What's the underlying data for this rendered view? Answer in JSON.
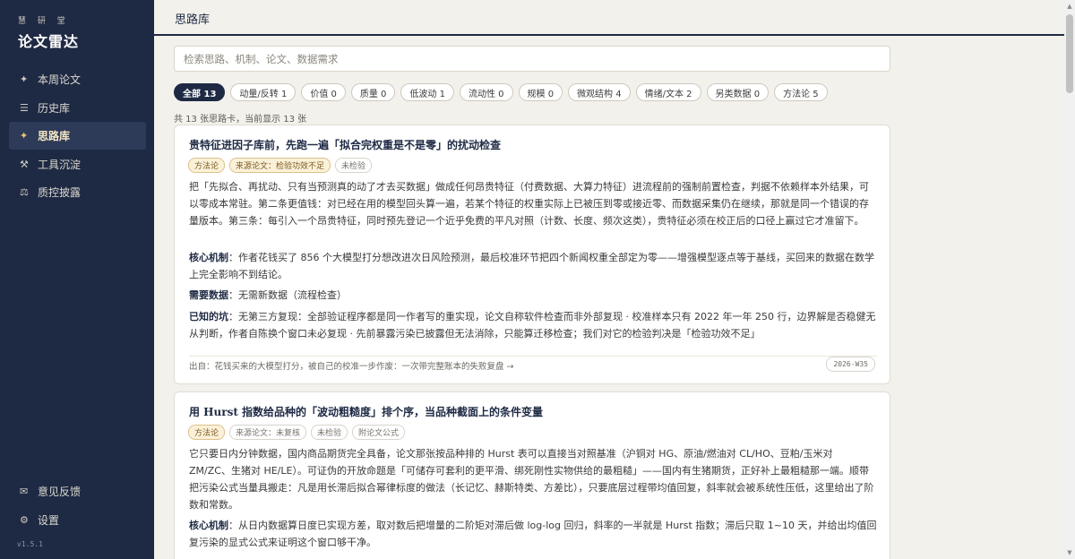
{
  "sidebar": {
    "brand_small": "慧 研 堂",
    "brand": "论文雷达",
    "items": [
      {
        "icon": "✦",
        "label": "本周论文"
      },
      {
        "icon": "☰",
        "label": "历史库"
      },
      {
        "icon": "✦",
        "label": "思路库"
      },
      {
        "icon": "⚒",
        "label": "工具沉淀"
      },
      {
        "icon": "⚖",
        "label": "质控披露"
      }
    ],
    "bottom_items": [
      {
        "icon": "✉",
        "label": "意见反馈"
      },
      {
        "icon": "⚙",
        "label": "设置"
      }
    ],
    "version": "v1.5.1"
  },
  "header": {
    "title": "思路库"
  },
  "search": {
    "placeholder": "检索思路、机制、论文、数据需求"
  },
  "filters": [
    "全部 13",
    "动量/反转 1",
    "价值 0",
    "质量 0",
    "低波动 1",
    "流动性 0",
    "规模 0",
    "微观结构 4",
    "情绪/文本 2",
    "另类数据 0",
    "方法论 5"
  ],
  "count_text": "共 13 张思路卡，当前显示 13 张",
  "cards": [
    {
      "title": "贵特征进因子库前，先跑一遍「拟合完权重是不是零」的扰动检查",
      "tags": [
        "方法论",
        "来源论文：检验功效不足",
        "未检验"
      ],
      "body": "把「先拟合、再扰动、只有当预测真的动了才去买数据」做成任何昂贵特征（付费数据、大算力特征）进流程前的强制前置检查，判据不依赖样本外结果，可以零成本常驻。第二条更值钱：对已经在用的模型回头算一遍，若某个特征的权重实际上已被压到零或接近零、而数据采集仍在继续，那就是同一个错误的存量版本。第三条：每引入一个昂贵特征，同时预先登记一个近乎免费的平凡对照（计数、长度、频次这类），贵特征必须在校正后的口径上赢过它才准留下。",
      "mech_label": "核心机制",
      "mech": "：作者花钱买了 856 个大模型打分想改进次日风险预测，最后校准环节把四个新闻权重全部定为零——增强模型逐点等于基线，买回来的数据在数学上完全影响不到结论。",
      "data_label": "需要数据",
      "data": "：无需新数据（流程检查）",
      "pit_label": "已知的坑",
      "pit": "：无第三方复现：全部验证程序都是同一作者写的重实现，论文自称软件检查而非外部复现 · 校准样本只有 2022 年一年 250 行，边界解是否稳健无从判断，作者自陈换个窗口未必复现 · 先前暴露污染已披露但无法消除，只能算迁移检查；我们对它的检验判决是「检验功效不足」",
      "origin": "出自：花钱买来的大模型打分，被自己的校准一步作废：一次带完整账本的失败复盘 →",
      "week": "2026-W35"
    },
    {
      "title": "用 Hurst 指数给品种的「波动粗糙度」排个序，当品种截面上的条件变量",
      "tags": [
        "方法论",
        "来源论文：未复核",
        "未检验",
        "附论文公式"
      ],
      "body": "它只要日内分钟数据，国内商品期货完全具备，论文那张按品种排的 Hurst 表可以直接当对照基准（沪铜对 HG、原油/燃油对 CL/HO、豆粕/玉米对 ZM/ZC、生猪对 HE/LE）。可证伪的开放命题是「可储存可套利的更平滑、绑死刚性实物供给的最粗糙」——国内有生猪期货，正好补上最粗糙那一端。顺带把污染公式当量具搬走：凡是用长滞后拟合幂律标度的做法（长记忆、赫斯特类、方差比），只要底层过程带均值回复，斜率就会被系统性压低，这里给出了阶数和常数。",
      "mech_label": "核心机制",
      "mech": "：从日内数据算日度已实现方差，取对数后把增量的二阶矩对滞后做 log-log 回归，斜率的一半就是 Hurst 指数；滞后只取 1~10 天，并给出均值回复污染的显式公式来证明这个窗口够干净。"
    }
  ]
}
